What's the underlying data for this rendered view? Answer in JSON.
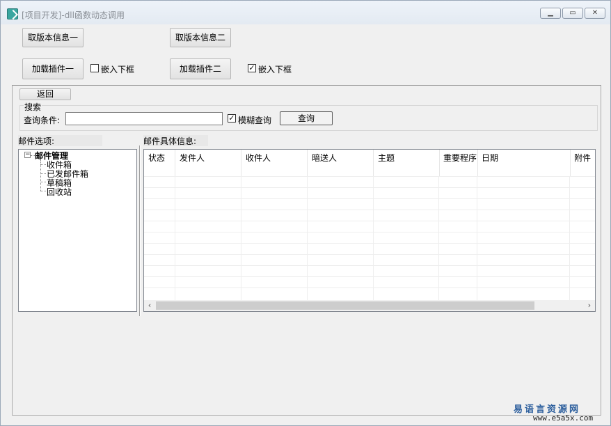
{
  "window": {
    "title": "[项目开发]-dll函数动态调用"
  },
  "buttons": {
    "get_version_1": "取版本信息一",
    "get_version_2": "取版本信息二",
    "load_plugin_1": "加载插件一",
    "load_plugin_2": "加载插件二",
    "back": "返回",
    "query": "查询"
  },
  "checkboxes": {
    "embed_1": {
      "label": "嵌入下框",
      "checked": false
    },
    "embed_2": {
      "label": "嵌入下框",
      "checked": true
    },
    "fuzzy": {
      "label": "模糊查询",
      "checked": true
    }
  },
  "search": {
    "group_label": "搜索",
    "condition_label": "查询条件:",
    "value": ""
  },
  "mail_options": {
    "label": "邮件选项:"
  },
  "mail_details": {
    "label": "邮件具体信息:"
  },
  "tree": {
    "root": "邮件管理",
    "items": [
      "收件箱",
      "已发邮件箱",
      "草稿箱",
      "回收站"
    ]
  },
  "table": {
    "columns": [
      "状态",
      "发件人",
      "收件人",
      "暗送人",
      "主题",
      "重要程序",
      "日期",
      "附件"
    ]
  },
  "watermark": {
    "line1": "易语言资源网",
    "line2": "www.e5a5x.com"
  }
}
